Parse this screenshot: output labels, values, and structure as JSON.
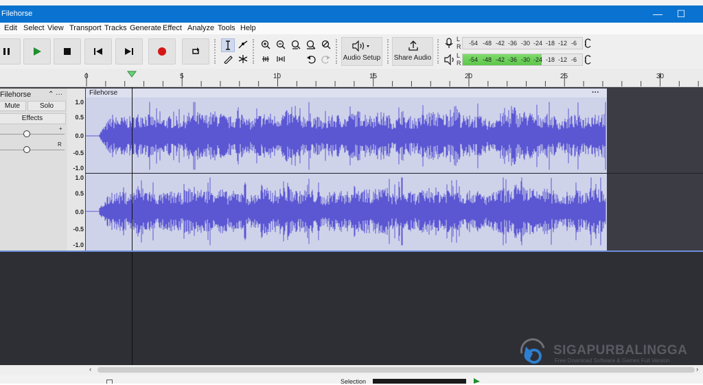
{
  "window": {
    "title": "Filehorse",
    "minimize": "—",
    "maximize": "☐"
  },
  "menu": [
    "Edit",
    "Select",
    "View",
    "Transport",
    "Tracks",
    "Generate",
    "Effect",
    "Analyze",
    "Tools",
    "Help"
  ],
  "toolbar": {
    "audio_setup": "Audio Setup",
    "share_audio": "Share Audio",
    "record_meter": {
      "l": "L",
      "r": "R",
      "ticks": [
        "-54",
        "-48",
        "-42",
        "-36",
        "-30",
        "-24",
        "-18",
        "-12",
        "-6"
      ]
    },
    "play_meter": {
      "l": "L",
      "r": "R",
      "ticks": [
        "-54",
        "-48",
        "-42",
        "-36",
        "-30",
        "-24",
        "-18",
        "-12",
        "-6"
      ],
      "level_fraction": 0.66
    }
  },
  "ruler": {
    "ticks": [
      "0",
      "5",
      "10",
      "15",
      "20",
      "25",
      "30"
    ]
  },
  "track": {
    "name": "Filehorse",
    "menu": "⌃ ···",
    "mute": "Mute",
    "solo": "Solo",
    "effects": "Effects",
    "pan_r": "R",
    "gain_plus": "+",
    "clip_name": "Filehorse",
    "clip_menu": "···",
    "scale": [
      "1.0",
      "0.5",
      "0.0",
      "-0.5",
      "-1.0"
    ],
    "waveform_color": "#5b57d3"
  },
  "watermark": {
    "name": "SIGAPURBALINGGA",
    "tagline": "Free Download Software & Games Full Version"
  },
  "status": {
    "selection": "Selection"
  }
}
